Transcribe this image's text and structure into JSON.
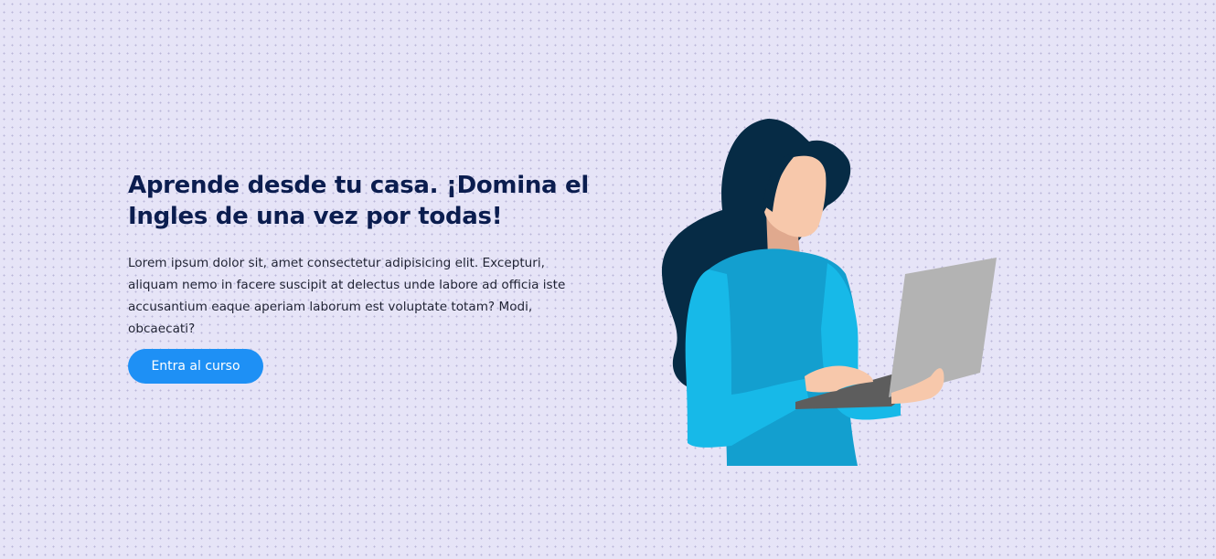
{
  "hero": {
    "title": "Aprende desde tu casa. ¡Domina el Ingles de una vez por todas!",
    "description": "Lorem ipsum dolor sit, amet consectetur adipisicing elit. Excepturi, aliquam nemo in facere suscipit at delectus unde labore ad officia iste accusantium eaque aperiam laborum est voluptate totam? Modi, obcaecati?",
    "cta_label": "Entra al curso",
    "illustration": "woman-with-laptop-illustration"
  },
  "colors": {
    "background": "#e6e4f7",
    "title": "#0b1d4f",
    "button": "#1e90f5",
    "hair": "#062b45",
    "shirt": "#139fcf",
    "sleeve": "#17b9e8",
    "skin": "#f7c8ab",
    "laptop": "#b3b3b3"
  }
}
